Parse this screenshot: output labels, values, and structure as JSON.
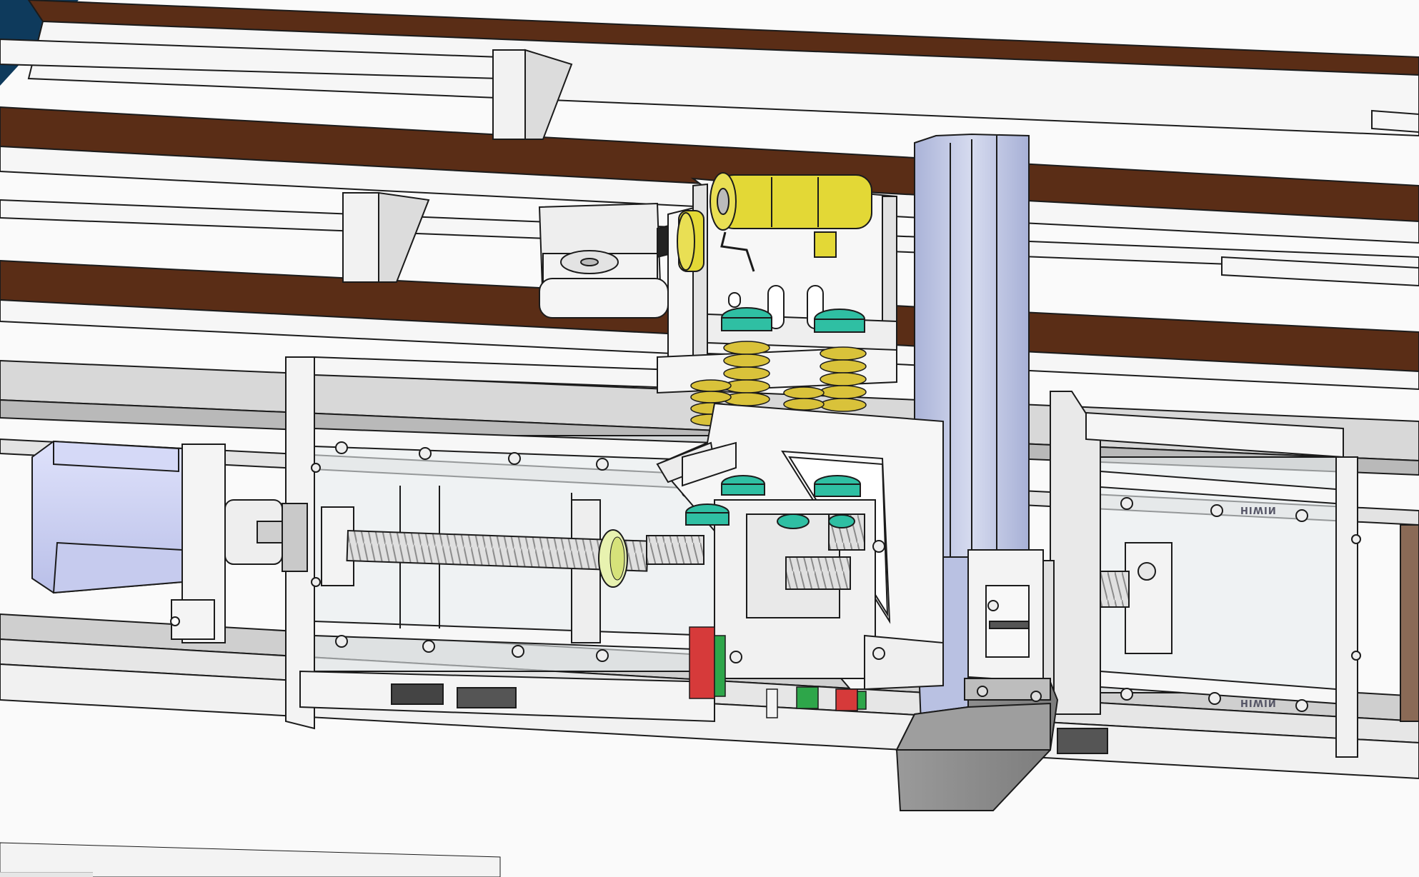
{
  "viewport": {
    "background": "#fafafa",
    "corner_tab_color": "#0e3a5c"
  },
  "model_colors": {
    "wood_beam": "#5a2d16",
    "frame_white": "#f6f6f6",
    "outline": "#1b1b1b",
    "aluminum_profile": "#c6cde6",
    "stepper_motor": "#cfd4f4",
    "rollers": "#e3d836",
    "springs": "#d9c23a",
    "collars": "#2fbfa3",
    "nut_green": "#e8f2b0",
    "lead_screw": "#d4d4d4",
    "motor_box": "#8c8c8c",
    "red_block": "#d63a3a",
    "green_block": "#2ea64a",
    "glass_panel": "#e8ecef"
  },
  "rail_engravings": [
    "HIWIN",
    "HIWIN"
  ]
}
